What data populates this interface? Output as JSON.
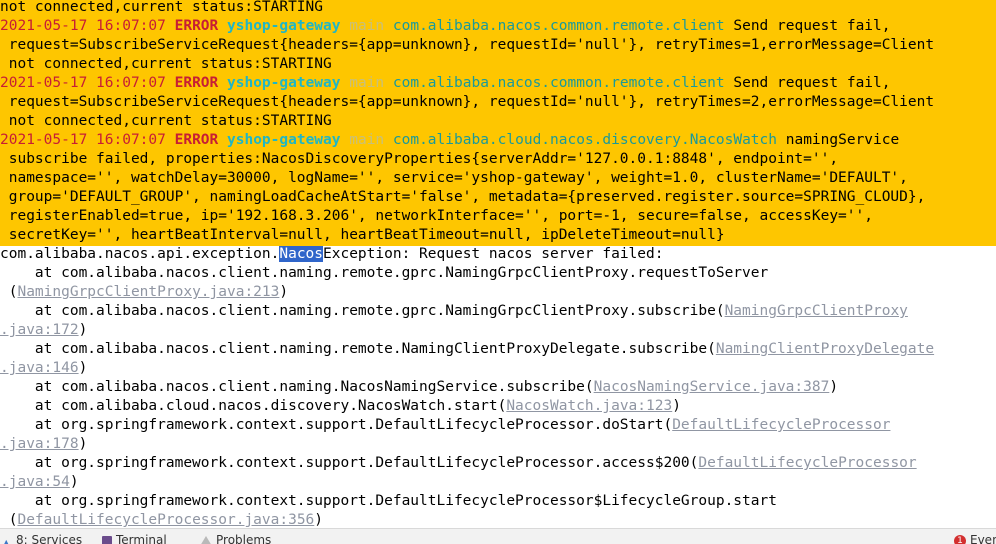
{
  "log": {
    "l0": "not connected,current status:STARTING",
    "e1": {
      "ts": "2021-05-17 16:07:07",
      "level": "ERROR",
      "app": "yshop-gateway",
      "thread": "main",
      "logger": "com.alibaba.nacos.common.remote.client",
      "msg": " Send request fail,",
      "cont1": " request=SubscribeServiceRequest{headers={app=unknown}, requestId='null'}, retryTimes=1,errorMessage=Client",
      "cont2": " not connected,current status:STARTING"
    },
    "e2": {
      "ts": "2021-05-17 16:07:07",
      "level": "ERROR",
      "app": "yshop-gateway",
      "thread": "main",
      "logger": "com.alibaba.nacos.common.remote.client",
      "msg": " Send request fail,",
      "cont1": " request=SubscribeServiceRequest{headers={app=unknown}, requestId='null'}, retryTimes=2,errorMessage=Client",
      "cont2": " not connected,current status:STARTING"
    },
    "e3": {
      "ts": "2021-05-17 16:07:07",
      "level": "ERROR",
      "app": "yshop-gateway",
      "thread": "main",
      "logger": "com.alibaba.cloud.nacos.discovery.NacosWatch",
      "msg": " namingService",
      "cont1": " subscribe failed, properties:NacosDiscoveryProperties{serverAddr='127.0.0.1:8848', endpoint='',",
      "cont2": " namespace='', watchDelay=30000, logName='', service='yshop-gateway', weight=1.0, clusterName='DEFAULT',",
      "cont3": " group='DEFAULT_GROUP', namingLoadCacheAtStart='false', metadata={preserved.register.source=SPRING_CLOUD},",
      "cont4": " registerEnabled=true, ip='192.168.3.206', networkInterface='', port=-1, secure=false, accessKey='',",
      "cont5": " secretKey='', heartBeatInterval=null, heartBeatTimeout=null, ipDeleteTimeout=null}"
    },
    "exception": {
      "pre": "com.alibaba.nacos.api.exception.",
      "sel": "Nacos",
      "post": "Exception: Request nacos server failed:"
    },
    "stack": {
      "s1": "    at com.alibaba.nacos.client.naming.remote.gprc.NamingGrpcClientProxy.requestToServer",
      "s1b_pre": " (",
      "s1b_link": "NamingGrpcClientProxy.java:213",
      "s1b_post": ")",
      "s2": "    at com.alibaba.nacos.client.naming.remote.gprc.NamingGrpcClientProxy.subscribe(",
      "s2_link": "NamingGrpcClientProxy",
      "s2b_link": ".java:172",
      "s2b_post": ")",
      "s3": "    at com.alibaba.nacos.client.naming.remote.NamingClientProxyDelegate.subscribe(",
      "s3_link": "NamingClientProxyDelegate",
      "s3b_link": ".java:146",
      "s3b_post": ")",
      "s4": "    at com.alibaba.nacos.client.naming.NacosNamingService.subscribe(",
      "s4_link": "NacosNamingService.java:387",
      "s4_post": ")",
      "s5": "    at com.alibaba.cloud.nacos.discovery.NacosWatch.start(",
      "s5_link": "NacosWatch.java:123",
      "s5_post": ")",
      "s6": "    at org.springframework.context.support.DefaultLifecycleProcessor.doStart(",
      "s6_link": "DefaultLifecycleProcessor",
      "s6b_link": ".java:178",
      "s6b_post": ")",
      "s7": "    at org.springframework.context.support.DefaultLifecycleProcessor.access$200(",
      "s7_link": "DefaultLifecycleProcessor",
      "s7b_link": ".java:54",
      "s7b_post": ")",
      "s8": "    at org.springframework.context.support.DefaultLifecycleProcessor$LifecycleGroup.start",
      "s8b_pre": " (",
      "s8b_link": "DefaultLifecycleProcessor.java:356",
      "s8b_post": ")"
    }
  },
  "statusbar": {
    "services": "8: Services",
    "terminal": "Terminal",
    "problems": "Problems",
    "event_count": "1",
    "event_label": "Even"
  },
  "colors": {
    "highlight_bg": "#fec600",
    "error": "#c71e35",
    "app": "#1fb6c6",
    "logger": "#1a9a9a",
    "link": "#9096a3",
    "selection": "#2f65ca"
  }
}
